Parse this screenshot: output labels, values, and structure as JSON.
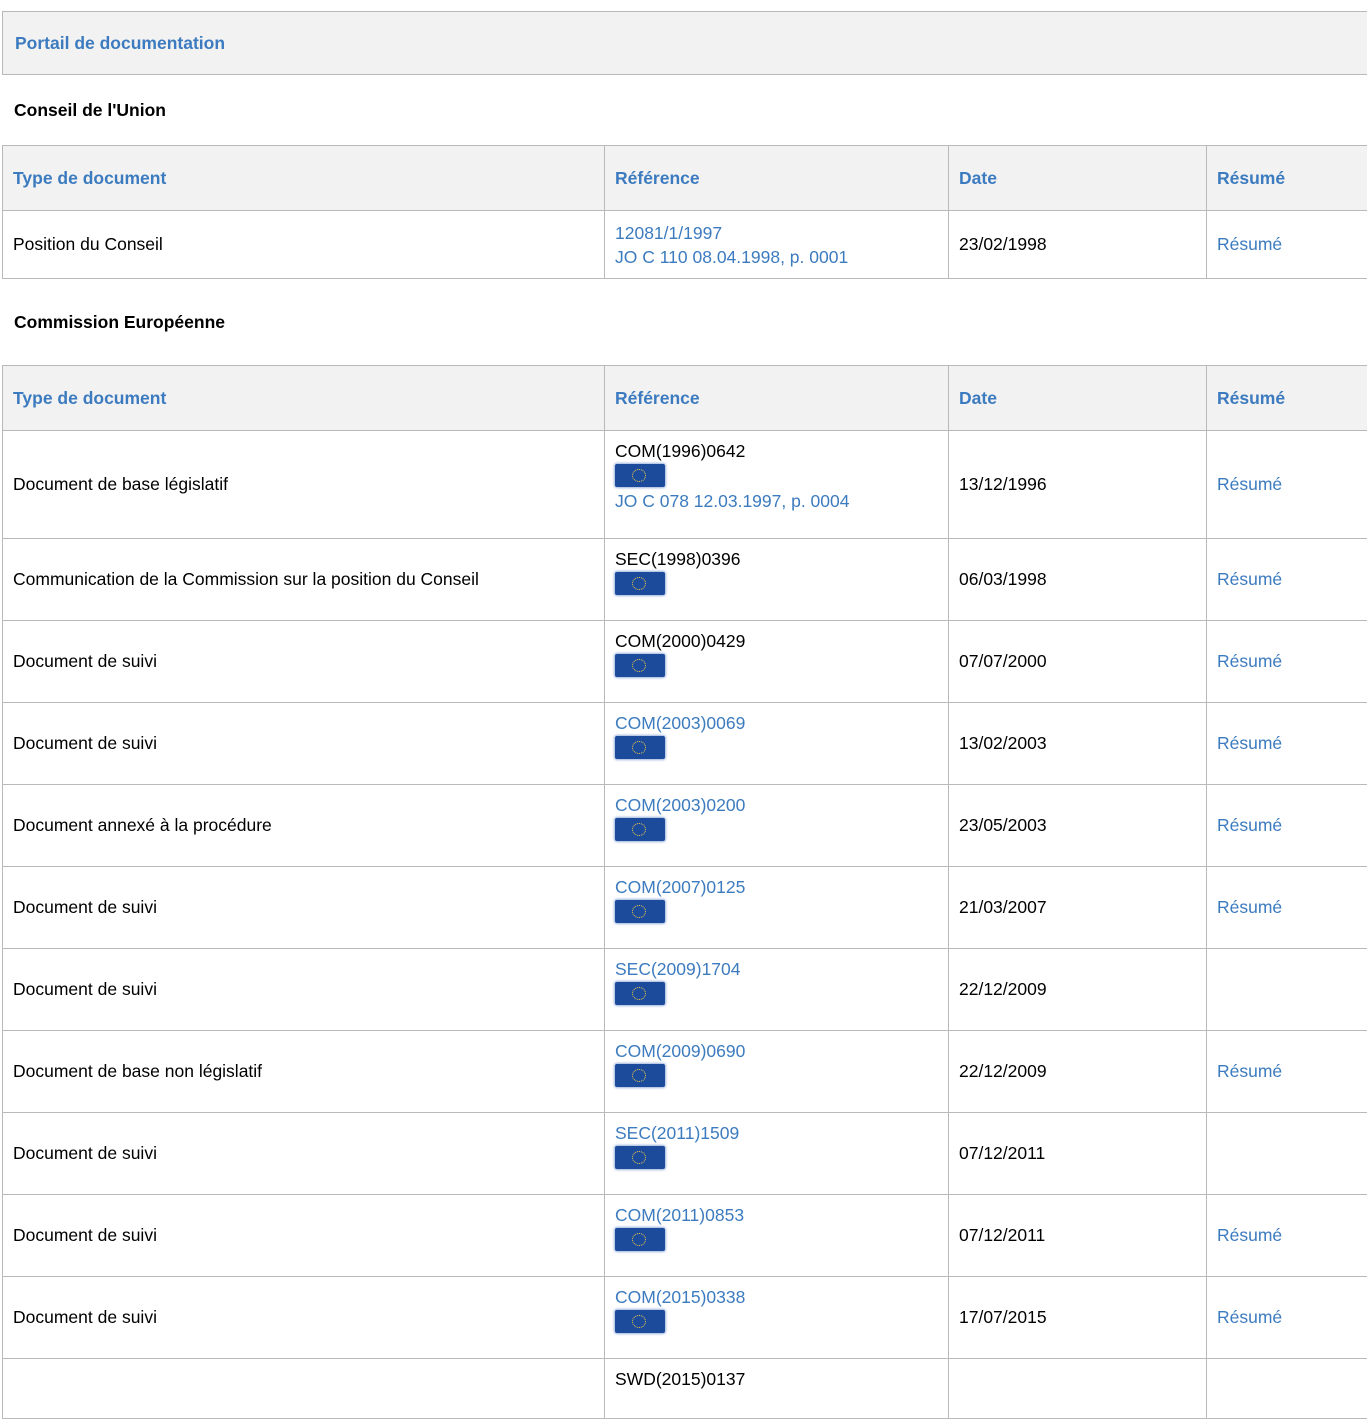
{
  "portal": {
    "title": "Portail de documentation"
  },
  "headers": {
    "type": "Type de document",
    "reference": "Référence",
    "date": "Date",
    "summary": "Résumé"
  },
  "council": {
    "title": "Conseil de l'Union",
    "rows": [
      {
        "type": "Position du Conseil",
        "ref": "12081/1/1997",
        "ref_is_link": true,
        "flag": false,
        "oj": "JO C 110 08.04.1998, p. 0001",
        "date": "23/02/1998",
        "summary": "Résumé"
      }
    ]
  },
  "commission": {
    "title": "Commission Européenne",
    "rows": [
      {
        "type": "Document de base législatif",
        "ref": "COM(1996)0642",
        "ref_is_link": false,
        "flag": true,
        "oj": "JO C 078 12.03.1997, p. 0004",
        "date": "13/12/1996",
        "summary": "Résumé"
      },
      {
        "type": "Communication de la Commission sur la position du Conseil",
        "ref": "SEC(1998)0396",
        "ref_is_link": false,
        "flag": true,
        "oj": "",
        "date": "06/03/1998",
        "summary": "Résumé"
      },
      {
        "type": "Document de suivi",
        "ref": "COM(2000)0429",
        "ref_is_link": false,
        "flag": true,
        "oj": "",
        "date": "07/07/2000",
        "summary": "Résumé"
      },
      {
        "type": "Document de suivi",
        "ref": "COM(2003)0069",
        "ref_is_link": true,
        "flag": true,
        "oj": "",
        "date": "13/02/2003",
        "summary": "Résumé"
      },
      {
        "type": "Document annexé à la procédure",
        "ref": "COM(2003)0200",
        "ref_is_link": true,
        "flag": true,
        "oj": "",
        "date": "23/05/2003",
        "summary": "Résumé"
      },
      {
        "type": "Document de suivi",
        "ref": "COM(2007)0125",
        "ref_is_link": true,
        "flag": true,
        "oj": "",
        "date": "21/03/2007",
        "summary": "Résumé"
      },
      {
        "type": "Document de suivi",
        "ref": "SEC(2009)1704",
        "ref_is_link": true,
        "flag": true,
        "oj": "",
        "date": "22/12/2009",
        "summary": ""
      },
      {
        "type": "Document de base non législatif",
        "ref": "COM(2009)0690",
        "ref_is_link": true,
        "flag": true,
        "oj": "",
        "date": "22/12/2009",
        "summary": "Résumé"
      },
      {
        "type": "Document de suivi",
        "ref": "SEC(2011)1509",
        "ref_is_link": true,
        "flag": true,
        "oj": "",
        "date": "07/12/2011",
        "summary": ""
      },
      {
        "type": "Document de suivi",
        "ref": "COM(2011)0853",
        "ref_is_link": true,
        "flag": true,
        "oj": "",
        "date": "07/12/2011",
        "summary": "Résumé"
      },
      {
        "type": "Document de suivi",
        "ref": "COM(2015)0338",
        "ref_is_link": true,
        "flag": true,
        "oj": "",
        "date": "17/07/2015",
        "summary": "Résumé"
      },
      {
        "type": "",
        "ref": "SWD(2015)0137",
        "ref_is_link": false,
        "flag": false,
        "oj": "",
        "date": "",
        "summary": ""
      }
    ]
  },
  "colors": {
    "link": "#3c7bbf",
    "header_bg": "#f2f2f2",
    "border": "#b9b9b9",
    "flag": "#1d4b9c"
  },
  "icons": {
    "flag": "eu-flag-icon"
  }
}
